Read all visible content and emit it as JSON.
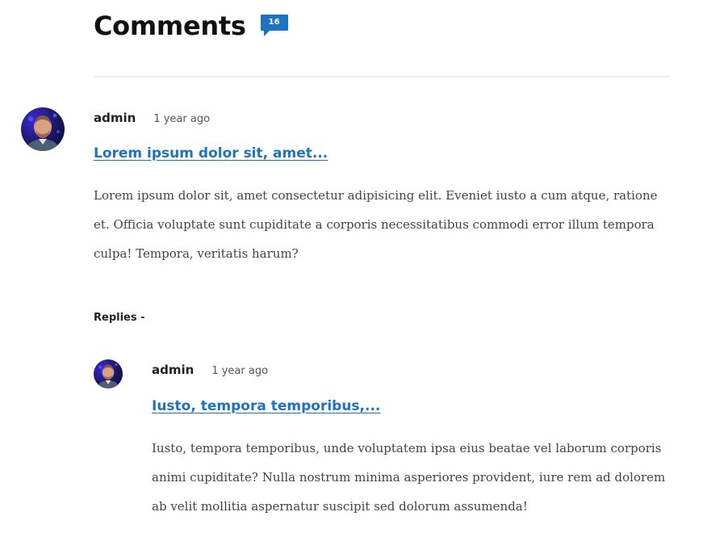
{
  "header": {
    "title": "Comments",
    "comment_count": "16"
  },
  "comments": [
    {
      "author": "admin",
      "time": "1 year ago",
      "title": "Lorem ipsum dolor sit, amet...",
      "body": "Lorem ipsum dolor sit, amet consectetur adipisicing elit. Eveniet iusto a cum atque, ratione et. Officia voluptate sunt cupiditate a corporis necessitatibus commodi error illum tempora culpa! Tempora, veritatis harum?"
    }
  ],
  "replies_label": "Replies -",
  "replies": [
    {
      "author": "admin",
      "time": "1 year ago",
      "title": "Iusto, tempora temporibus,...",
      "body": "Iusto, tempora temporibus, unde voluptatem ipsa eius beatae vel laborum corporis animi cupiditate? Nulla nostrum minima asperiores provident, iure rem ad dolorem ab velit mollitia aspernatur suscipit sed dolorum assumenda!"
    }
  ],
  "colors": {
    "accent": "#1e73be",
    "divider": "#eceff2"
  }
}
